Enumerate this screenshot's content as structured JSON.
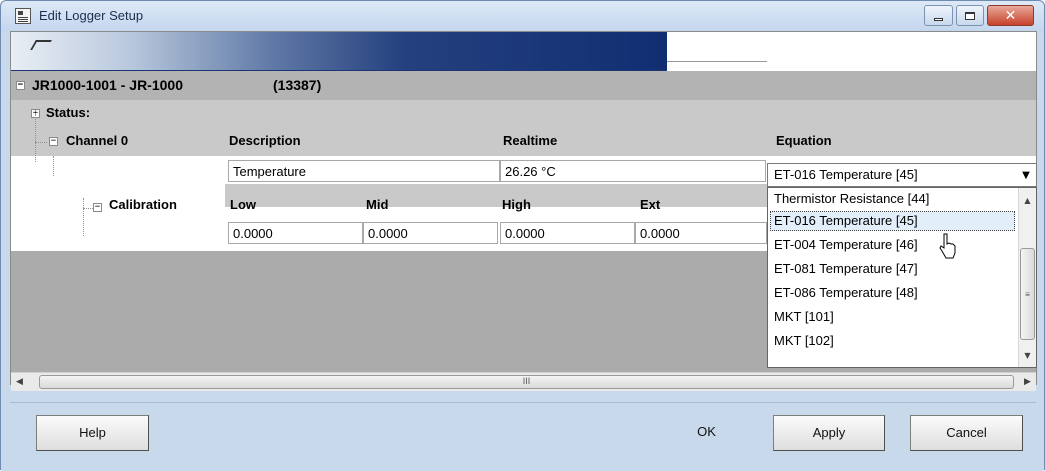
{
  "window": {
    "title": "Edit Logger Setup"
  },
  "tree": {
    "root_label": "JR1000-1001 - JR-1000",
    "root_id": "(13387)",
    "status_label": "Status:",
    "channel_label": "Channel 0",
    "calibration_label": "Calibration"
  },
  "channel": {
    "headers": {
      "description": "Description",
      "realtime": "Realtime",
      "equation": "Equation"
    },
    "description_value": "Temperature",
    "realtime_value": "26.26 °C",
    "equation_value": "ET-016 Temperature  [45]"
  },
  "calibration": {
    "headers": {
      "low": "Low",
      "mid": "Mid",
      "high": "High",
      "ext": "Ext"
    },
    "values": {
      "low": "0.0000",
      "mid": "0.0000",
      "high": "0.0000",
      "ext": "0.0000"
    }
  },
  "equation_dropdown": {
    "options": [
      "Thermistor Resistance  [44]",
      "ET-016 Temperature  [45]",
      "ET-004 Temperature  [46]",
      "ET-081 Temperature  [47]",
      "ET-086 Temperature  [48]",
      "MKT  [101]",
      "MKT  [102]"
    ],
    "highlighted": "ET-016 Temperature  [45]"
  },
  "buttons": {
    "help": "Help",
    "ok": "OK",
    "apply": "Apply",
    "cancel": "Cancel"
  },
  "icons": {
    "app": "logger-setup-icon",
    "scroll_grip": "III"
  }
}
